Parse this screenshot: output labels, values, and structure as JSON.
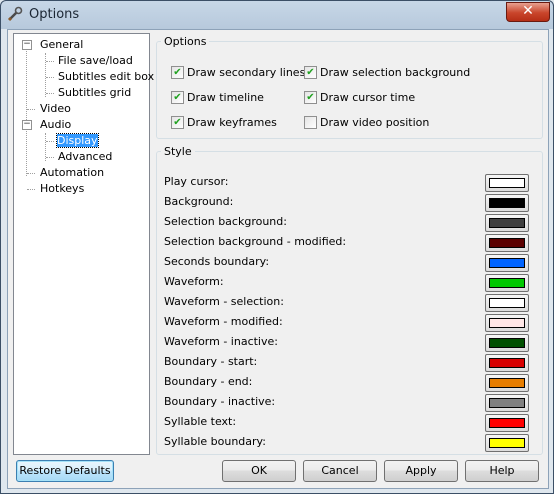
{
  "window": {
    "title": "Options",
    "close_glyph": "✕",
    "icon": "tools-icon"
  },
  "tree": {
    "items": [
      {
        "label": "General",
        "toggle": "−"
      },
      {
        "label": "File save/load"
      },
      {
        "label": "Subtitles edit box"
      },
      {
        "label": "Subtitles grid"
      },
      {
        "label": "Video"
      },
      {
        "label": "Audio",
        "toggle": "−"
      },
      {
        "label": "Display"
      },
      {
        "label": "Advanced"
      },
      {
        "label": "Automation"
      },
      {
        "label": "Hotkeys"
      }
    ],
    "selected": "Display"
  },
  "options": {
    "legend": "Options",
    "checks": [
      {
        "label": "Draw secondary lines",
        "checked": true
      },
      {
        "label": "Draw selection background",
        "checked": true
      },
      {
        "label": "Draw timeline",
        "checked": true
      },
      {
        "label": "Draw cursor time",
        "checked": true
      },
      {
        "label": "Draw keyframes",
        "checked": true
      },
      {
        "label": "Draw video position",
        "checked": false
      }
    ]
  },
  "style": {
    "legend": "Style",
    "rows": [
      {
        "label": "Play cursor:",
        "color": "#ffffff"
      },
      {
        "label": "Background:",
        "color": "#000000"
      },
      {
        "label": "Selection background:",
        "color": "#404040"
      },
      {
        "label": "Selection background - modified:",
        "color": "#5c0000"
      },
      {
        "label": "Seconds boundary:",
        "color": "#0064ff"
      },
      {
        "label": "Waveform:",
        "color": "#00c800"
      },
      {
        "label": "Waveform - selection:",
        "color": "#ffffff"
      },
      {
        "label": "Waveform - modified:",
        "color": "#ffe6e6"
      },
      {
        "label": "Waveform - inactive:",
        "color": "#005000"
      },
      {
        "label": "Boundary - start:",
        "color": "#d80000"
      },
      {
        "label": "Boundary - end:",
        "color": "#e67d00"
      },
      {
        "label": "Boundary - inactive:",
        "color": "#808080"
      },
      {
        "label": "Syllable text:",
        "color": "#ff0000"
      },
      {
        "label": "Syllable boundary:",
        "color": "#ffff00"
      }
    ]
  },
  "buttons": {
    "restore": "Restore Defaults",
    "ok": "OK",
    "cancel": "Cancel",
    "apply": "Apply",
    "help": "Help"
  }
}
